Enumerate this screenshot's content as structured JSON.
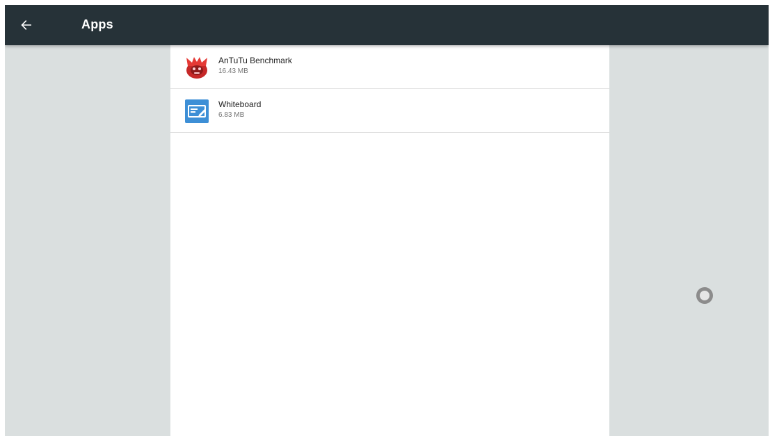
{
  "toolbar": {
    "title": "Apps",
    "back_icon": "arrow-back-icon",
    "background": "#263238"
  },
  "apps": [
    {
      "name": "AnTuTu Benchmark",
      "size": "16.43 MB",
      "icon": "antutu-icon",
      "icon_color": "#d32f2f"
    },
    {
      "name": "Whiteboard",
      "size": "6.83 MB",
      "icon": "whiteboard-icon",
      "icon_color": "#3d8fd6"
    }
  ],
  "home_button": {
    "icon": "home-circle-icon"
  }
}
